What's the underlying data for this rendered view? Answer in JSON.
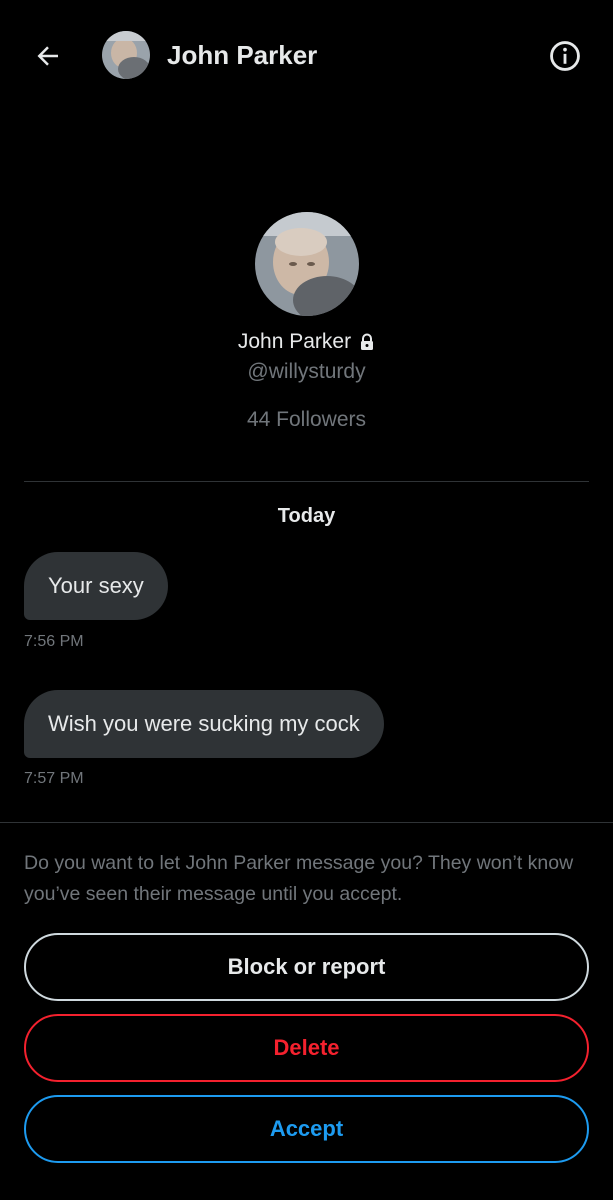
{
  "header": {
    "name": "John Parker",
    "back_icon": "arrow-left-icon",
    "info_icon": "info-circle-icon"
  },
  "profile": {
    "name": "John Parker",
    "handle": "@willysturdy",
    "followers": "44 Followers",
    "lock_icon": "lock-icon"
  },
  "conversation": {
    "date_label": "Today",
    "messages": [
      {
        "text": "Your sexy",
        "time": "7:56 PM"
      },
      {
        "text": "Wish you were sucking my cock",
        "time": "7:57 PM"
      }
    ]
  },
  "request": {
    "prompt": "Do you want to let John Parker message you? They won’t know you’ve seen their message until you accept.",
    "block_label": "Block or report",
    "delete_label": "Delete",
    "accept_label": "Accept"
  },
  "colors": {
    "background": "#000000",
    "bubble": "#2f3336",
    "muted": "#71767b",
    "danger": "#f4212e",
    "accent": "#1d9bf0"
  }
}
